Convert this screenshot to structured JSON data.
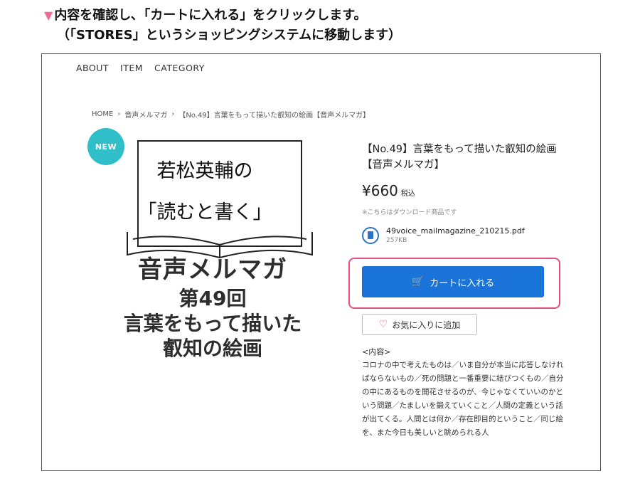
{
  "instruction": {
    "line1": "内容を確認し､「カートに入れる」をクリックします。",
    "line2": "（「STORES」というショッピングシステムに移動します）",
    "arrow_icon": "down-triangle-icon",
    "arrow_color": "#f06a9a"
  },
  "nav": {
    "items": [
      "ABOUT",
      "ITEM",
      "CATEGORY"
    ]
  },
  "breadcrumb": {
    "items": [
      "HOME",
      "音声メルマガ",
      "【No.49】言葉をもって描いた叡知の絵画【音声メルマガ】"
    ],
    "separator_icon": "chevron-right-icon"
  },
  "badge": {
    "label": "NEW",
    "color": "#30bfc9"
  },
  "cover": {
    "book_title": "若松英輔の",
    "book_subtitle": "「読むと書く」",
    "main": "音声メルマガ",
    "line1": "第49回",
    "line2": "言葉をもって描いた",
    "line3": "叡知の絵画"
  },
  "product": {
    "title": "【No.49】言葉をもって描いた叡知の絵画【音声メルマガ】",
    "price": "¥660",
    "tax_label": "税込",
    "download_note": "※こちらはダウンロード商品です",
    "file_name": "49voice_mailmagazine_210215.pdf",
    "file_size": "257KB",
    "file_icon": "document-icon"
  },
  "cart": {
    "label": "カートに入れる",
    "icon": "cart-icon",
    "color": "#1a73d9",
    "highlight_color": "#e24f7e"
  },
  "favorite": {
    "label": "お気に入りに追加",
    "icon": "heart-icon"
  },
  "description": {
    "label": "<内容>",
    "text": "コロナの中で考えたものは／いま自分が本当に応答しなければならないもの／死の問題と一番重要に結びつくもの／自分の中にあるものを開花させるのが、今じゃなくていいのかという問題／たましいを鍛えていくこと／人間の定義という話が出てくる。人間とは何か／存在即目的ということ／同じ絵を、また今日も美しいと眺められる人"
  }
}
